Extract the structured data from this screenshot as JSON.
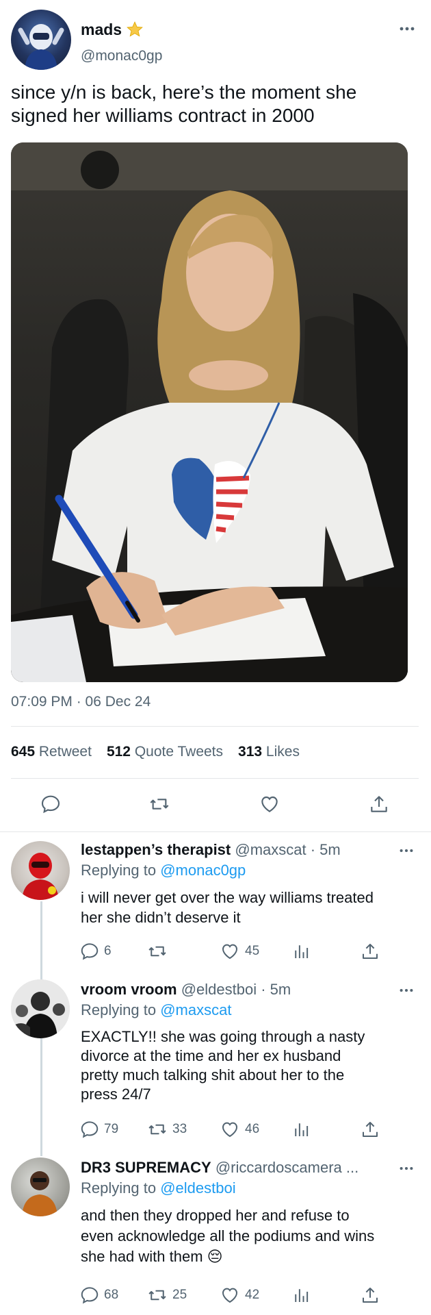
{
  "main_tweet": {
    "display_name": "mads",
    "name_emoji": "⭐",
    "handle": "@monac0gp",
    "text_line1": "since y/n is back, here’s the moment she",
    "text_line2": "signed her williams contract in 2000",
    "timestamp": "07:09 PM · 06 Dec 24",
    "stats": [
      {
        "count": "645",
        "label": "Retweet"
      },
      {
        "count": "512",
        "label": "Quote Tweets"
      },
      {
        "count": "313",
        "label": "Likes"
      }
    ]
  },
  "replies": [
    {
      "name": "lestappen’s therapist",
      "meta": "@maxscat · 5m",
      "replying_prefix": "Replying to",
      "replying_to": "@monac0gp",
      "lines": [
        "i will never get over the way williams treated",
        "her she didn’t deserve it"
      ],
      "reply_count": "6",
      "retweet_count": "",
      "like_count": "45"
    },
    {
      "name": "vroom vroom",
      "meta": "@eldestboi · 5m",
      "replying_prefix": "Replying to",
      "replying_to": "@maxscat",
      "lines": [
        "EXACTLY!! she was going through a nasty",
        "divorce at the time and her ex husband",
        "pretty much talking shit about her to the",
        "press 24/7"
      ],
      "reply_count": "79",
      "retweet_count": "33",
      "like_count": "46"
    },
    {
      "name": "DR3 SUPREMACY",
      "meta": "@riccardoscamera ...",
      "replying_prefix": "Replying to",
      "replying_to": "@eldestboi",
      "lines": [
        "and then they dropped her and refuse to",
        "even acknowledge all the podiums and wins",
        "she had with them 😔"
      ],
      "reply_count": "68",
      "retweet_count": "25",
      "like_count": "42"
    }
  ]
}
